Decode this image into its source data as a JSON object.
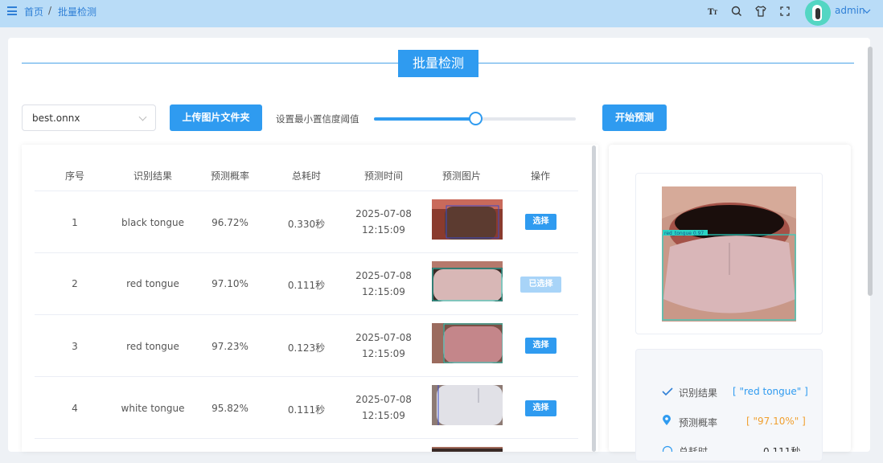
{
  "header": {
    "breadcrumb": [
      "首页",
      "批量检测"
    ],
    "breadcrumb_sep": "/",
    "icons": [
      "font-size-icon",
      "search-icon",
      "shirt-icon",
      "fullscreen-icon"
    ],
    "username": "admin"
  },
  "page": {
    "title": "批量检测",
    "model_select_value": "best.onnx",
    "upload_label": "上传图片文件夹",
    "threshold_label": "设置最小置信度阈值",
    "threshold_value": 0.5,
    "start_label": "开始预测"
  },
  "table": {
    "headers": [
      "序号",
      "识别结果",
      "预测概率",
      "总耗时",
      "预测时间",
      "预测图片",
      "操作"
    ],
    "rows": [
      {
        "index": "1",
        "result": "black tongue",
        "prob": "96.72%",
        "time_cost": "0.330秒",
        "date": "2025-07-08",
        "clock": "12:15:09",
        "action": "选择",
        "selected": false
      },
      {
        "index": "2",
        "result": "red tongue",
        "prob": "97.10%",
        "time_cost": "0.111秒",
        "date": "2025-07-08",
        "clock": "12:15:09",
        "action": "已选择",
        "selected": true
      },
      {
        "index": "3",
        "result": "red tongue",
        "prob": "97.23%",
        "time_cost": "0.123秒",
        "date": "2025-07-08",
        "clock": "12:15:09",
        "action": "选择",
        "selected": false
      },
      {
        "index": "4",
        "result": "white tongue",
        "prob": "95.82%",
        "time_cost": "0.111秒",
        "date": "2025-07-08",
        "clock": "12:15:09",
        "action": "选择",
        "selected": false
      }
    ]
  },
  "detail": {
    "bbox_label": "red_tongue 0.97",
    "result_label": "识别结果",
    "result_value": "[ \"red tongue\" ]",
    "prob_label": "预测概率",
    "prob_value": "[ \"97.10%\" ]",
    "time_label": "总耗时",
    "time_value": "0.111秒"
  },
  "colors": {
    "primary": "#2f9bf0",
    "header_bg": "#b9dcf7",
    "prob_value": "#f0a030",
    "result_value": "#2f9bf0"
  }
}
